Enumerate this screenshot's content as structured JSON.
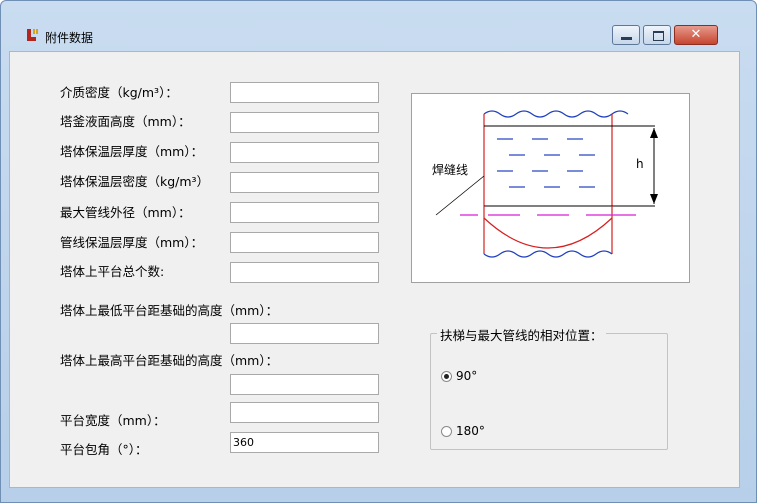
{
  "window": {
    "title": "附件数据",
    "icon": "app-logo-icon",
    "controls": {
      "minimize": "minimize-icon",
      "maximize": "maximize-icon",
      "close": "close-icon"
    }
  },
  "form": {
    "density_label": "介质密度（kg/m³）：",
    "density_value": "",
    "level_label": "塔釜液面高度（mm）：",
    "level_value": "",
    "insul_thickness_label": "塔体保温层厚度（mm）：",
    "insul_thickness_value": "",
    "insul_density_label": "塔体保温层密度（kg/m³）",
    "insul_density_value": "",
    "pipe_od_label": "最大管线外径（mm）：",
    "pipe_od_value": "",
    "pipe_insul_label": "管线保温层厚度（mm）：",
    "pipe_insul_value": "",
    "platform_count_label": "塔体上平台总个数:",
    "platform_count_value": "",
    "lowest_platform_label": "塔体上最低平台距基础的高度（mm）：",
    "lowest_platform_value": "",
    "highest_platform_label": "塔体上最高平台距基础的高度（mm）：",
    "highest_platform_value": "",
    "platform_width_label": "平台宽度（mm）：",
    "platform_width_value": "",
    "platform_angle_label": "平台包角（°）：",
    "platform_angle_value": "360"
  },
  "diagram": {
    "weld_label": "焊缝线",
    "h_label": "h"
  },
  "ladder_group": {
    "legend": "扶梯与最大管线的相对位置：",
    "options": [
      {
        "label": "90°",
        "checked": true
      },
      {
        "label": "180°",
        "checked": false
      }
    ]
  }
}
